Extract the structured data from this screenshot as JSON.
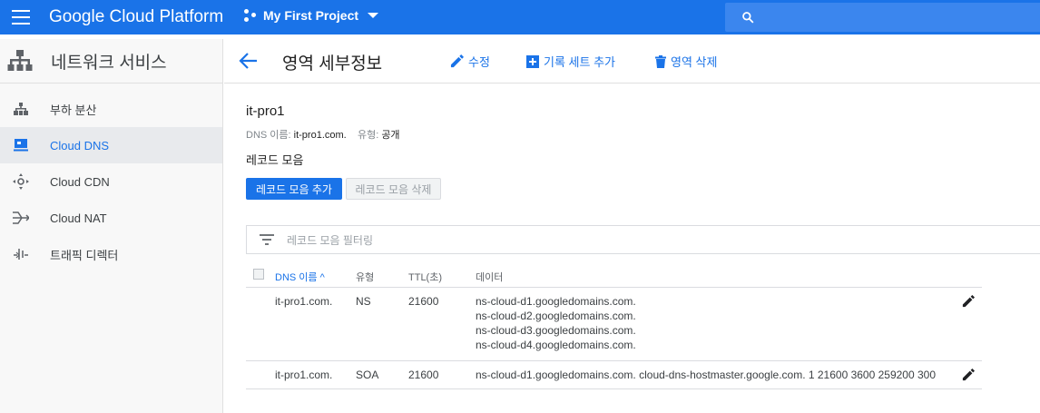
{
  "topbar": {
    "app_title": "Google Cloud Platform",
    "project_name": "My First Project",
    "colors": {
      "bar": "#1a73e8"
    }
  },
  "sidebar": {
    "title": "네트워크 서비스",
    "items": [
      {
        "label": "부하 분산",
        "icon": "load-balancing-icon",
        "active": false
      },
      {
        "label": "Cloud DNS",
        "icon": "cloud-dns-icon",
        "active": true
      },
      {
        "label": "Cloud CDN",
        "icon": "cloud-cdn-icon",
        "active": false
      },
      {
        "label": "Cloud NAT",
        "icon": "cloud-nat-icon",
        "active": false
      },
      {
        "label": "트래픽 디렉터",
        "icon": "traffic-director-icon",
        "active": false
      }
    ]
  },
  "header": {
    "title": "영역 세부정보",
    "edit_label": "수정",
    "add_record_set_label": "기록 세트 추가",
    "delete_zone_label": "영역 삭제"
  },
  "zone": {
    "name": "it-pro1",
    "dns_name_label": "DNS 이름:",
    "dns_name_value": "it-pro1.com.",
    "type_label": "유형:",
    "type_value": "공개"
  },
  "records": {
    "section_title": "레코드 모음",
    "add_button": "레코드 모음 추가",
    "delete_button": "레코드 모음 삭제",
    "filter_placeholder": "레코드 모음 필터링",
    "columns": {
      "dns_name": "DNS 이름",
      "sort_indicator": "^",
      "type": "유형",
      "ttl": "TTL(초)",
      "data": "데이터"
    },
    "rows": [
      {
        "dns_name": "it-pro1.com.",
        "type": "NS",
        "ttl": "21600",
        "data": [
          "ns-cloud-d1.googledomains.com.",
          "ns-cloud-d2.googledomains.com.",
          "ns-cloud-d3.googledomains.com.",
          "ns-cloud-d4.googledomains.com."
        ]
      },
      {
        "dns_name": "it-pro1.com.",
        "type": "SOA",
        "ttl": "21600",
        "data": [
          "ns-cloud-d1.googledomains.com. cloud-dns-hostmaster.google.com. 1 21600 3600 259200 300"
        ]
      }
    ]
  }
}
